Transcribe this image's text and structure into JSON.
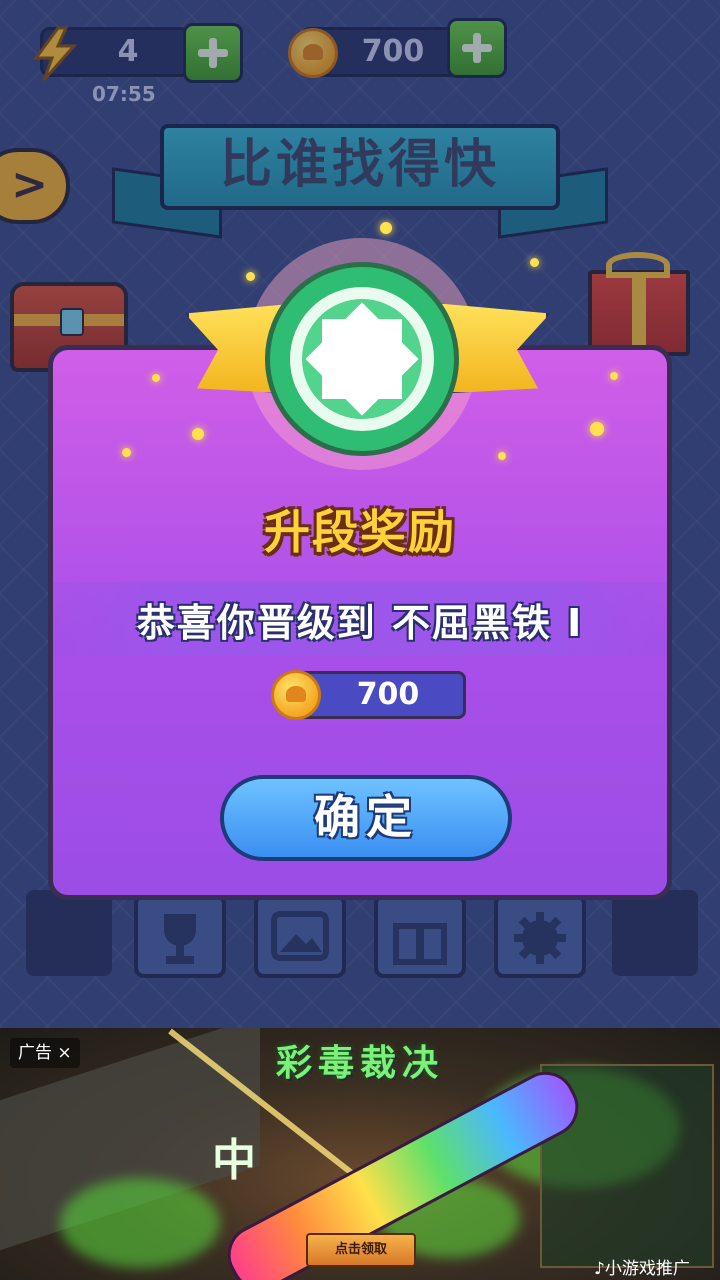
{
  "top_bar": {
    "energy_value": "4",
    "energy_timer": "07:55",
    "coin_value": "700"
  },
  "game": {
    "title": "比谁找得快"
  },
  "modal": {
    "title": "升段奖励",
    "message": "恭喜你晋级到 不屈黑铁 I",
    "reward_amount": "700",
    "confirm_label": "确定"
  },
  "ad": {
    "label": "广告 ×",
    "headline": "彩毒裁决",
    "overlay_char": "中",
    "cta_label": "点击领取",
    "source_label": "♪小游戏推广"
  },
  "colors": {
    "modal_bg": "#b052e8",
    "title_gold": "#ffd23a",
    "confirm_blue": "#4a9cf5",
    "plus_green": "#4fb035",
    "coin_gold": "#f5a623"
  }
}
